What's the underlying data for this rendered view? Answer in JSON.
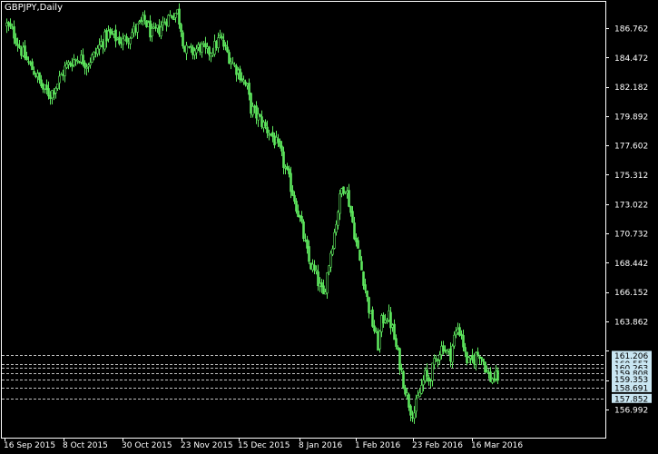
{
  "chart_data": {
    "type": "candlestick",
    "title": "GBPJPY,Daily",
    "colors": {
      "background": "#000000",
      "candle": "#5ee65e",
      "bull_body": "#000000",
      "axis": "#ffffff",
      "text": "#ffffff",
      "level_line": "#c0c0c0",
      "level_box": "#c9e6f2"
    },
    "x_tick_labels": [
      "16 Sep 2015",
      "8 Oct 2015",
      "30 Oct 2015",
      "23 Nov 2015",
      "15 Dec 2015",
      "8 Jan 2016",
      "1 Feb 2016",
      "23 Feb 2016",
      "16 Mar 2016"
    ],
    "y_tick_labels": [
      "186.762",
      "184.472",
      "182.182",
      "179.892",
      "177.602",
      "175.312",
      "173.022",
      "170.732",
      "168.442",
      "166.152",
      "163.862",
      "156.992"
    ],
    "y_ticks": [
      186.762,
      184.472,
      182.182,
      179.892,
      177.602,
      175.312,
      173.022,
      170.732,
      168.442,
      166.152,
      163.862,
      161.572,
      159.282,
      156.992
    ],
    "ylim": [
      155.7,
      188.3
    ],
    "levels": [
      {
        "value": 161.206,
        "label": "161.206"
      },
      {
        "value": 160.557,
        "label": "160.557"
      },
      {
        "value": 160.263,
        "label": "160.263"
      },
      {
        "value": 159.808,
        "label": "159.808"
      },
      {
        "value": 159.353,
        "label": "159.353"
      },
      {
        "value": 158.691,
        "label": "158.691"
      },
      {
        "value": 157.852,
        "label": "157.852"
      }
    ],
    "grid": false,
    "close_path": [
      [
        0,
        187.0
      ],
      [
        4,
        186.3
      ],
      [
        8,
        185.0
      ],
      [
        12,
        184.0
      ],
      [
        16,
        183.2
      ],
      [
        20,
        182.0
      ],
      [
        24,
        181.6
      ],
      [
        28,
        182.5
      ],
      [
        32,
        183.6
      ],
      [
        36,
        184.2
      ],
      [
        40,
        184.5
      ],
      [
        44,
        184.0
      ],
      [
        48,
        184.6
      ],
      [
        52,
        185.6
      ],
      [
        56,
        186.3
      ],
      [
        60,
        186.0
      ],
      [
        64,
        185.7
      ],
      [
        68,
        186.3
      ],
      [
        72,
        186.8
      ],
      [
        76,
        187.4
      ],
      [
        80,
        186.2
      ],
      [
        84,
        186.7
      ],
      [
        88,
        187.5
      ],
      [
        92,
        187.9
      ],
      [
        94,
        188.0
      ],
      [
        96,
        186.8
      ],
      [
        98,
        185.0
      ],
      [
        102,
        184.9
      ],
      [
        106,
        185.3
      ],
      [
        110,
        184.8
      ],
      [
        114,
        185.3
      ],
      [
        117,
        186.0
      ],
      [
        120,
        185.1
      ],
      [
        124,
        184.0
      ],
      [
        128,
        183.2
      ],
      [
        132,
        182.0
      ],
      [
        134,
        180.5
      ],
      [
        138,
        179.8
      ],
      [
        142,
        179.0
      ],
      [
        146,
        178.3
      ],
      [
        150,
        177.1
      ],
      [
        154,
        175.3
      ],
      [
        158,
        173.5
      ],
      [
        162,
        171.2
      ],
      [
        164,
        169.8
      ],
      [
        166,
        168.5
      ],
      [
        168,
        168.0
      ],
      [
        170,
        167.4
      ],
      [
        172,
        166.5
      ],
      [
        174,
        165.8
      ],
      [
        176,
        167.6
      ],
      [
        178,
        169.3
      ],
      [
        180,
        170.8
      ],
      [
        182,
        172.6
      ],
      [
        184,
        174.2
      ],
      [
        186,
        174.5
      ],
      [
        188,
        173.2
      ],
      [
        190,
        171.6
      ],
      [
        192,
        170.0
      ],
      [
        194,
        168.6
      ],
      [
        196,
        167.2
      ],
      [
        198,
        165.6
      ],
      [
        200,
        164.2
      ],
      [
        202,
        163.2
      ],
      [
        204,
        162.0
      ],
      [
        206,
        163.8
      ],
      [
        208,
        164.3
      ],
      [
        210,
        164.2
      ],
      [
        212,
        163.2
      ],
      [
        214,
        161.8
      ],
      [
        216,
        160.6
      ],
      [
        218,
        159.2
      ],
      [
        220,
        158.0
      ],
      [
        222,
        157.0
      ],
      [
        224,
        156.8
      ],
      [
        226,
        157.8
      ],
      [
        228,
        158.8
      ],
      [
        230,
        159.6
      ],
      [
        232,
        159.3
      ],
      [
        234,
        160.1
      ],
      [
        236,
        160.9
      ],
      [
        238,
        161.6
      ],
      [
        240,
        162.0
      ],
      [
        242,
        161.4
      ],
      [
        244,
        161.3
      ],
      [
        246,
        162.6
      ],
      [
        248,
        163.3
      ],
      [
        250,
        162.9
      ],
      [
        252,
        161.2
      ],
      [
        254,
        160.6
      ],
      [
        256,
        160.7
      ],
      [
        258,
        161.2
      ],
      [
        260,
        161.4
      ],
      [
        262,
        160.8
      ],
      [
        264,
        159.9
      ],
      [
        266,
        159.4
      ],
      [
        268,
        159.4
      ],
      [
        270,
        159.5
      ]
    ]
  }
}
